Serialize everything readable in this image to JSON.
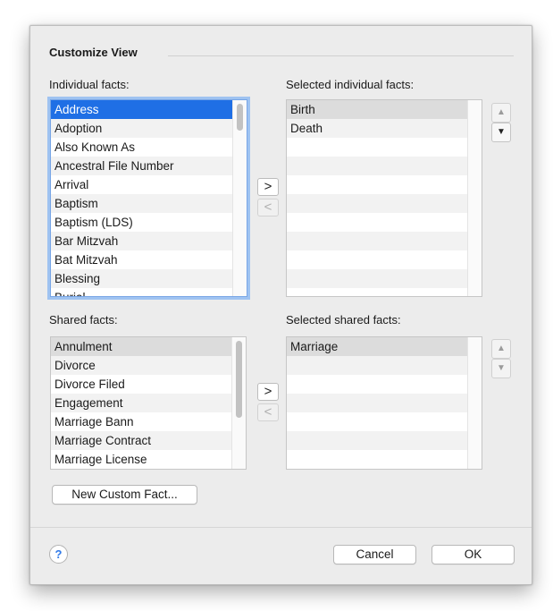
{
  "dialog": {
    "section_title": "Customize View",
    "individual": {
      "label": "Individual facts:",
      "items": [
        "Address",
        "Adoption",
        "Also Known As",
        "Ancestral File Number",
        "Arrival",
        "Baptism",
        "Baptism (LDS)",
        "Bar Mitzvah",
        "Bat Mitzvah",
        "Blessing",
        "Burial"
      ],
      "selected": "Address"
    },
    "selected_individual": {
      "label": "Selected individual facts:",
      "items": [
        "Birth",
        "Death"
      ],
      "selected": "Birth"
    },
    "shared": {
      "label": "Shared facts:",
      "items": [
        "Annulment",
        "Divorce",
        "Divorce Filed",
        "Engagement",
        "Marriage Bann",
        "Marriage Contract",
        "Marriage License"
      ],
      "selected": "Annulment"
    },
    "selected_shared": {
      "label": "Selected shared facts:",
      "items": [
        "Marriage"
      ],
      "selected": "Marriage"
    },
    "arrows": {
      "add": ">",
      "remove": "<",
      "up": "▲",
      "down": "▼"
    },
    "new_custom_fact_label": "New Custom Fact...",
    "help_label": "?",
    "cancel_label": "Cancel",
    "ok_label": "OK"
  },
  "colors": {
    "selection_blue": "#1f6fe5",
    "focus_ring": "#9fc3f1",
    "help_blue": "#2f79e8"
  }
}
